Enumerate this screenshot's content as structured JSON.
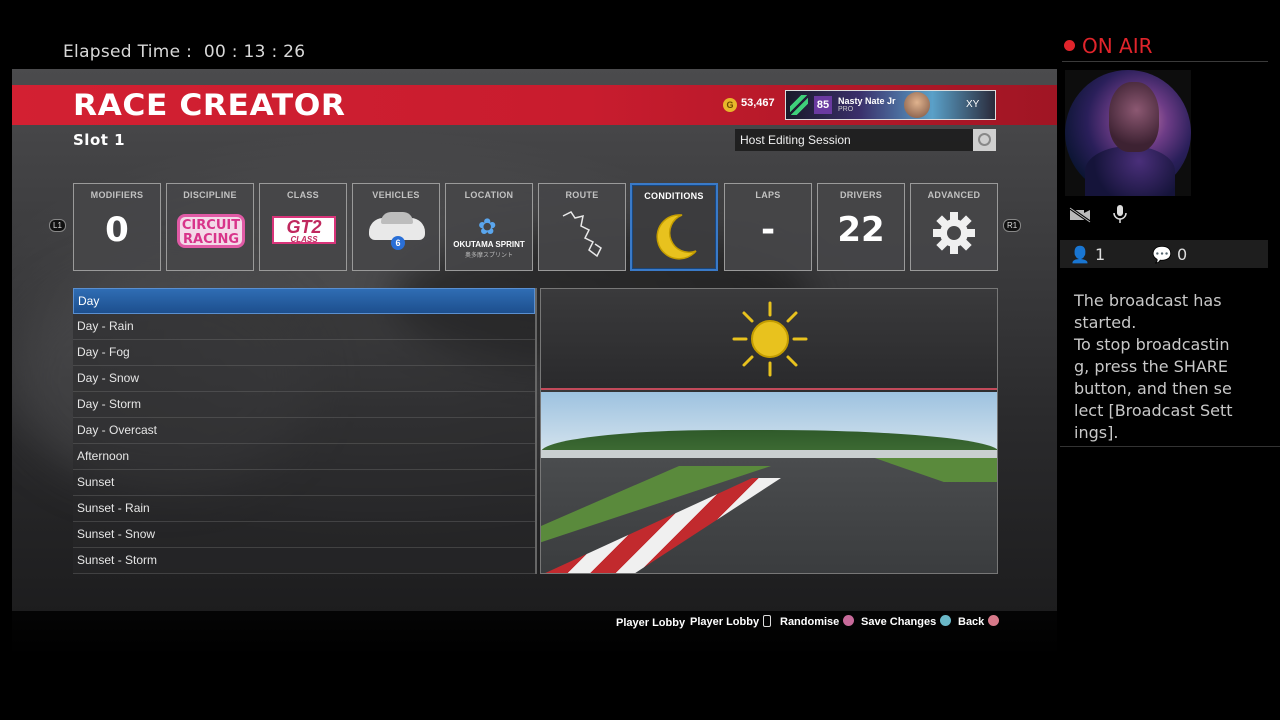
{
  "broadcast": {
    "elapsed_label": "Elapsed Time :",
    "elapsed_value": "00 : 13 : 26",
    "on_air": "ON AIR",
    "viewers": "1",
    "comments": "0",
    "message": "The broadcast has started.\nTo stop broadcasting, press the SHARE button, and then select [Broadcast Settings]."
  },
  "header": {
    "title": "RACE CREATOR",
    "credits": "53,467",
    "profile": {
      "level": "85",
      "name": "Nasty Nate Jr",
      "tier": "PRO",
      "tag": "XY"
    },
    "slot": "Slot 1",
    "host_session": "Host Editing Session"
  },
  "tabs": [
    {
      "label": "MODIFIERS",
      "value": "0"
    },
    {
      "label": "DISCIPLINE",
      "value": "CIRCUIT RACING"
    },
    {
      "label": "CLASS",
      "value": "GT2",
      "sub": "CLASS"
    },
    {
      "label": "VEHICLES",
      "value": "6"
    },
    {
      "label": "LOCATION",
      "value": "OKUTAMA SPRINT",
      "sub": "奥多摩スプリント"
    },
    {
      "label": "ROUTE",
      "value": ""
    },
    {
      "label": "CONDITIONS",
      "value": ""
    },
    {
      "label": "LAPS",
      "value": "-"
    },
    {
      "label": "DRIVERS",
      "value": "22"
    },
    {
      "label": "ADVANCED",
      "value": ""
    }
  ],
  "shoulder": {
    "left": "L1",
    "right": "R1"
  },
  "conditions": [
    "Day",
    "Day - Rain",
    "Day - Fog",
    "Day - Snow",
    "Day - Storm",
    "Day - Overcast",
    "Afternoon",
    "Sunset",
    "Sunset - Rain",
    "Sunset - Snow",
    "Sunset - Storm"
  ],
  "selected_condition": "Day",
  "footer": {
    "player_lobby_1": "Player Lobby",
    "player_lobby_2": "Player Lobby",
    "randomise": "Randomise",
    "save_changes": "Save Changes",
    "back": "Back"
  },
  "colors": {
    "header_red": "#c81c2e",
    "selection_blue": "#2f6db4",
    "on_air_red": "#e0242b",
    "conditions_yellow": "#e8c21e"
  }
}
